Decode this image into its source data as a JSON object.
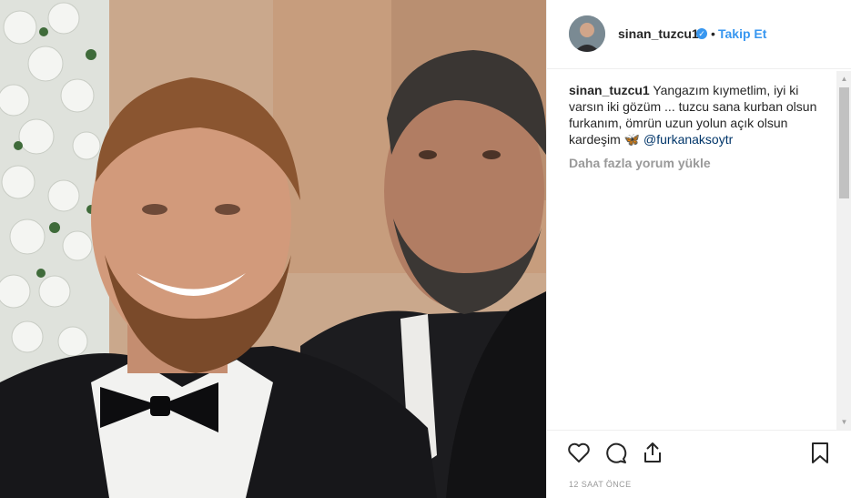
{
  "post": {
    "username": "sinan_tuzcu1",
    "verified_icon": "verified-badge-icon",
    "separator": "•",
    "follow_label": "Takip Et",
    "caption": {
      "username": "sinan_tuzcu1",
      "text": " Yangazım kıymetlim, iyi ki varsın iki gözüm ... tuzcu sana kurban olsun furkanım, ömrün uzun yolun açık olsun kardeşim 🦋 ",
      "mention": "@furkanaksoytr"
    },
    "load_more_label": "Daha fazla yorum yükle",
    "timestamp": "12 SAAT ÖNCE"
  },
  "icons": {
    "like": "heart-icon",
    "comment": "comment-icon",
    "share": "share-icon",
    "save": "bookmark-icon"
  },
  "colors": {
    "accent": "#3897f0",
    "text": "#262626",
    "muted": "#999999",
    "mention": "#003569"
  }
}
